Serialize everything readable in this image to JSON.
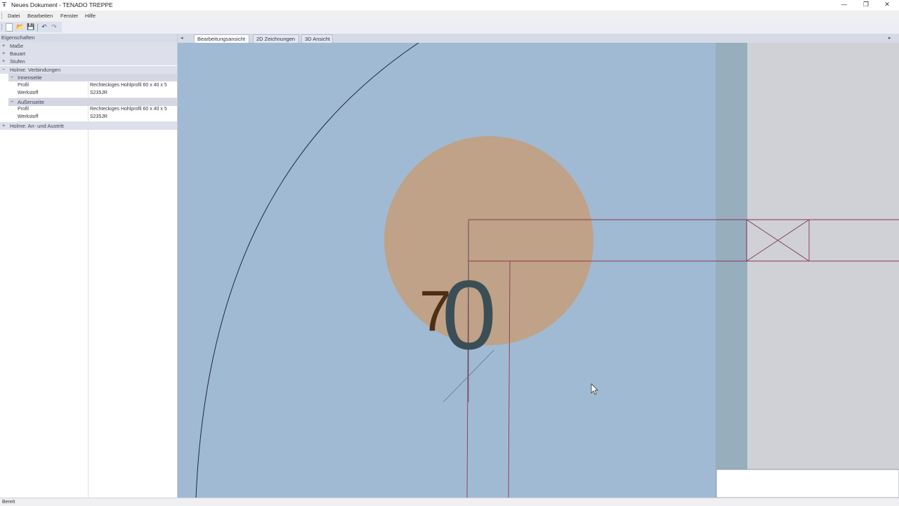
{
  "window": {
    "title": "Neues Dokument - TENADO TREPPE",
    "controls": {
      "minimize": "—",
      "maximize": "❐",
      "close": "✕"
    }
  },
  "menu": {
    "items": [
      "Datei",
      "Bearbeiten",
      "Fenster",
      "Hilfe"
    ]
  },
  "toolbar": {
    "icons": [
      "new-document-icon",
      "open-folder-icon",
      "save-icon",
      "undo-icon",
      "redo-icon"
    ],
    "glyphs": {
      "new": "",
      "open": "📂",
      "save": "💾",
      "undo": "↶",
      "redo": "↷"
    }
  },
  "properties": {
    "title": "Eigenschaften",
    "groups": [
      {
        "label": "Maße",
        "toggle": "+"
      },
      {
        "label": "Bauart",
        "toggle": "+"
      },
      {
        "label": "Stufen",
        "toggle": "+"
      },
      {
        "label": "Holme: Verbindungen",
        "toggle": "−"
      },
      {
        "label": "Holme: An- und Austritt",
        "toggle": "+"
      }
    ],
    "subgroups": [
      {
        "label": "Innenseite",
        "toggle": "−",
        "rows": [
          {
            "key": "Profil",
            "value": "Rechteckiges Hohlprofil 60 x 40 x 5"
          },
          {
            "key": "Werkstoff",
            "value": "S235JR"
          }
        ]
      },
      {
        "label": "Außenseite",
        "toggle": "−",
        "rows": [
          {
            "key": "Profil",
            "value": "Rechteckiges Hohlprofil 60 x 40 x 5"
          },
          {
            "key": "Werkstoff",
            "value": "S235JR"
          }
        ]
      }
    ]
  },
  "tabs": {
    "nav_left": "◂",
    "nav_right": "▸",
    "items": [
      {
        "label": "Bearbeitungsansicht",
        "active": true
      },
      {
        "label": "2D Zeichnungen",
        "active": false
      },
      {
        "label": "3D Ansicht",
        "active": false
      }
    ]
  },
  "drawing": {
    "dimension_text": "70",
    "colors": {
      "viewport": "#a1bad3",
      "margin_band": "#97aebd",
      "outside": "#cfd1d6",
      "highlight_circle": "#bfa287",
      "profile_lines": "#8e3555",
      "arc_line": "#1f2a3a",
      "digit_seven": "#4e2e14",
      "digit_zero": "#3b4e55"
    }
  },
  "status": {
    "text": "Bereit"
  }
}
